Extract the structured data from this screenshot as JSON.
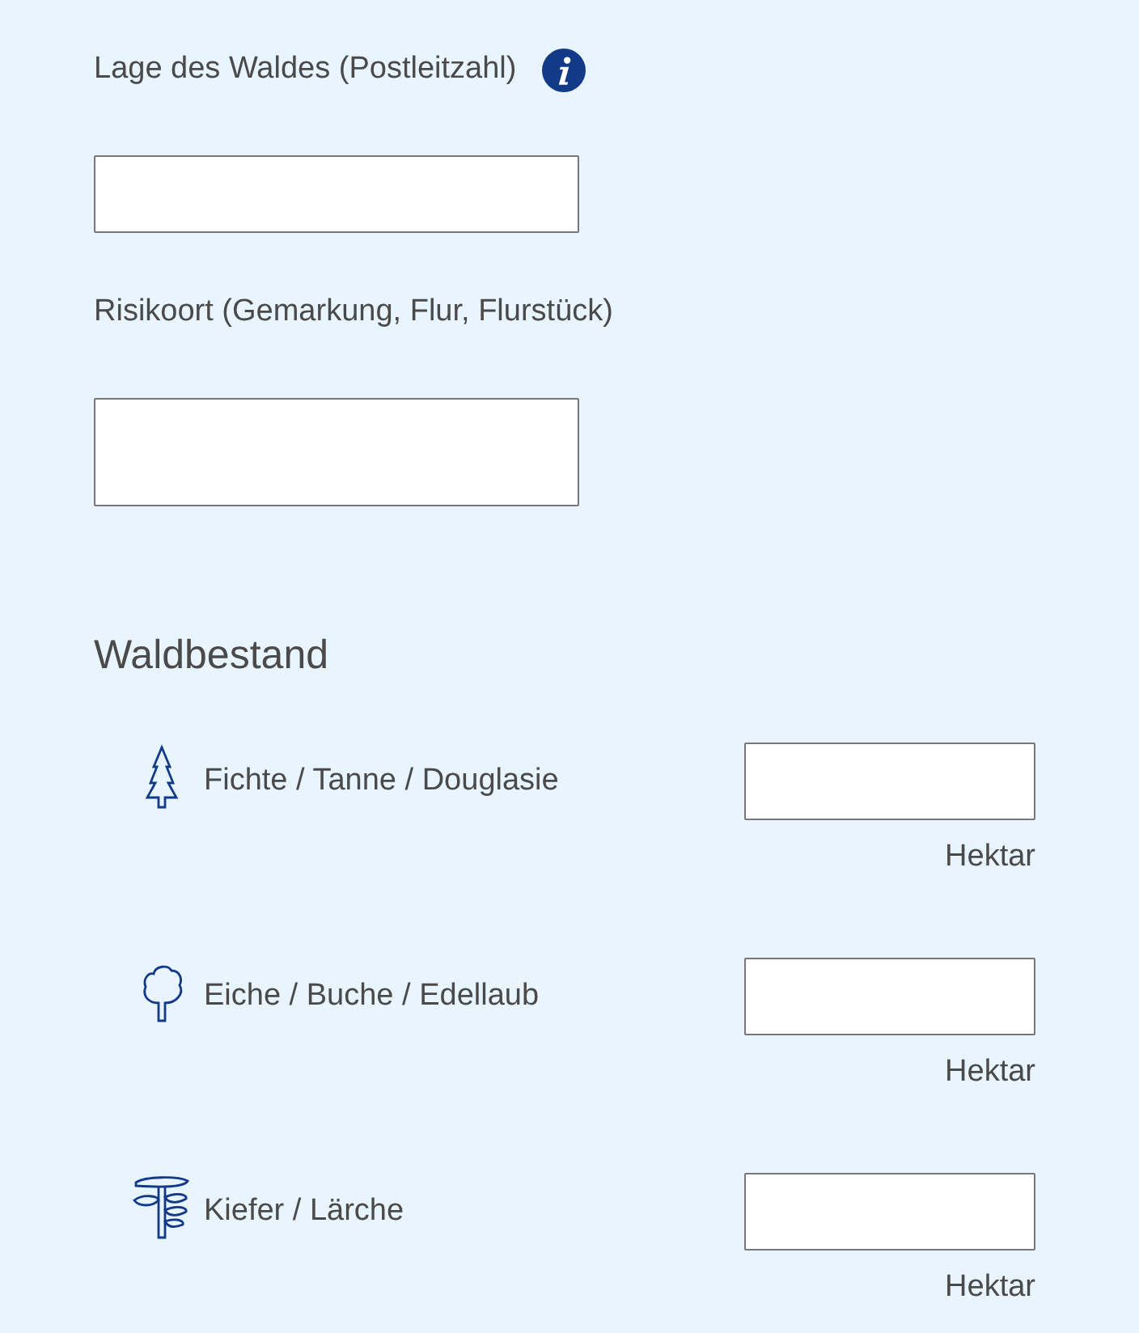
{
  "fields": [
    {
      "label": "Lage des Waldes (Postleitzahl)",
      "info": true,
      "kind": "line"
    },
    {
      "label": "Risikoort (Gemarkung, Flur, Flurstück)",
      "info": false,
      "kind": "area"
    }
  ],
  "section": {
    "title": "Waldbestand",
    "rows": [
      {
        "kind": "spruce",
        "label": "Fichte / Tanne / Douglasie",
        "unit": "Hektar"
      },
      {
        "kind": "deciduous",
        "label": "Eiche / Buche / Edellaub",
        "unit": "Hektar"
      },
      {
        "kind": "pine",
        "label": "Kiefer / Lärche",
        "unit": "Hektar"
      }
    ]
  }
}
